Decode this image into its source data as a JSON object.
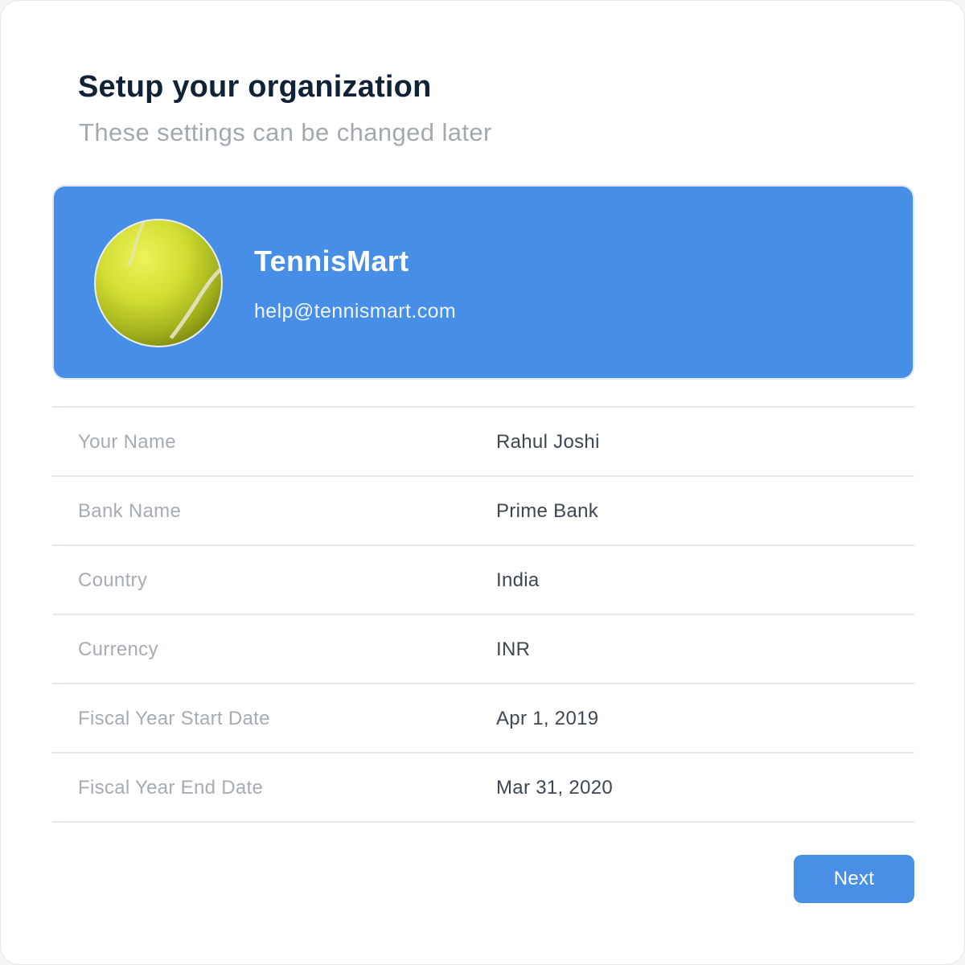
{
  "header": {
    "title": "Setup your organization",
    "subtitle": "These settings can be changed later"
  },
  "organization": {
    "name": "TennisMart",
    "email": "help@tennismart.com",
    "avatar_icon": "tennis-ball-icon",
    "card_color": "#478EE6"
  },
  "details": [
    {
      "label": "Your Name",
      "value": "Rahul Joshi"
    },
    {
      "label": "Bank Name",
      "value": "Prime Bank"
    },
    {
      "label": "Country",
      "value": "India"
    },
    {
      "label": "Currency",
      "value": "INR"
    },
    {
      "label": "Fiscal Year Start Date",
      "value": "Apr 1, 2019"
    },
    {
      "label": "Fiscal Year End Date",
      "value": "Mar 31, 2020"
    }
  ],
  "actions": {
    "next_label": "Next",
    "button_color": "#4A8FE6"
  }
}
